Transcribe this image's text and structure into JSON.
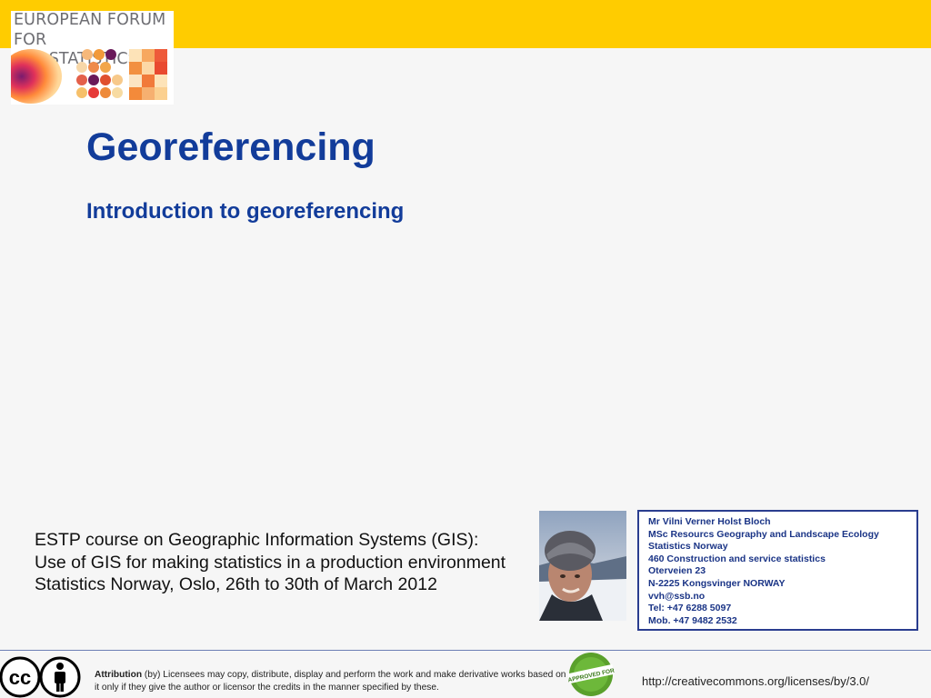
{
  "logo": {
    "line1": "EUROPEAN FORUM",
    "line2": "FOR GEOSTATISTICS"
  },
  "slide": {
    "title": "Georeferencing",
    "subtitle": "Introduction to georeferencing"
  },
  "course": {
    "lines": [
      "ESTP course on Geographic Information Systems (GIS):",
      "Use of GIS for making statistics in a production environment",
      "Statistics Norway, Oslo, 26th to 30th of March 2012"
    ]
  },
  "contact": {
    "lines": [
      "Mr Vilni Verner Holst Bloch",
      "MSc Resourcs Geography and Landscape Ecology",
      "Statistics Norway",
      "460 Construction and service statistics",
      "Oterveien 23",
      "N-2225 Kongsvinger NORWAY",
      "vvh@ssb.no",
      "Tel: +47 6288 5097",
      "Mob. +47 9482 2532"
    ]
  },
  "footer": {
    "cc_label": "cc",
    "attribution_label": "Attribution",
    "attribution_text": "(by) Licensees may copy, distribute, display and perform the work and make derivative works based on it only if they give the author or licensor the credits in the manner specified by these.",
    "badge_text": "APPROVED FOR",
    "url": "http://creativecommons.org/licenses/by/3.0/"
  },
  "colors": {
    "top_bar": "#ffcc00",
    "title": "#123c9a",
    "contact_border": "#2a3d8f"
  }
}
